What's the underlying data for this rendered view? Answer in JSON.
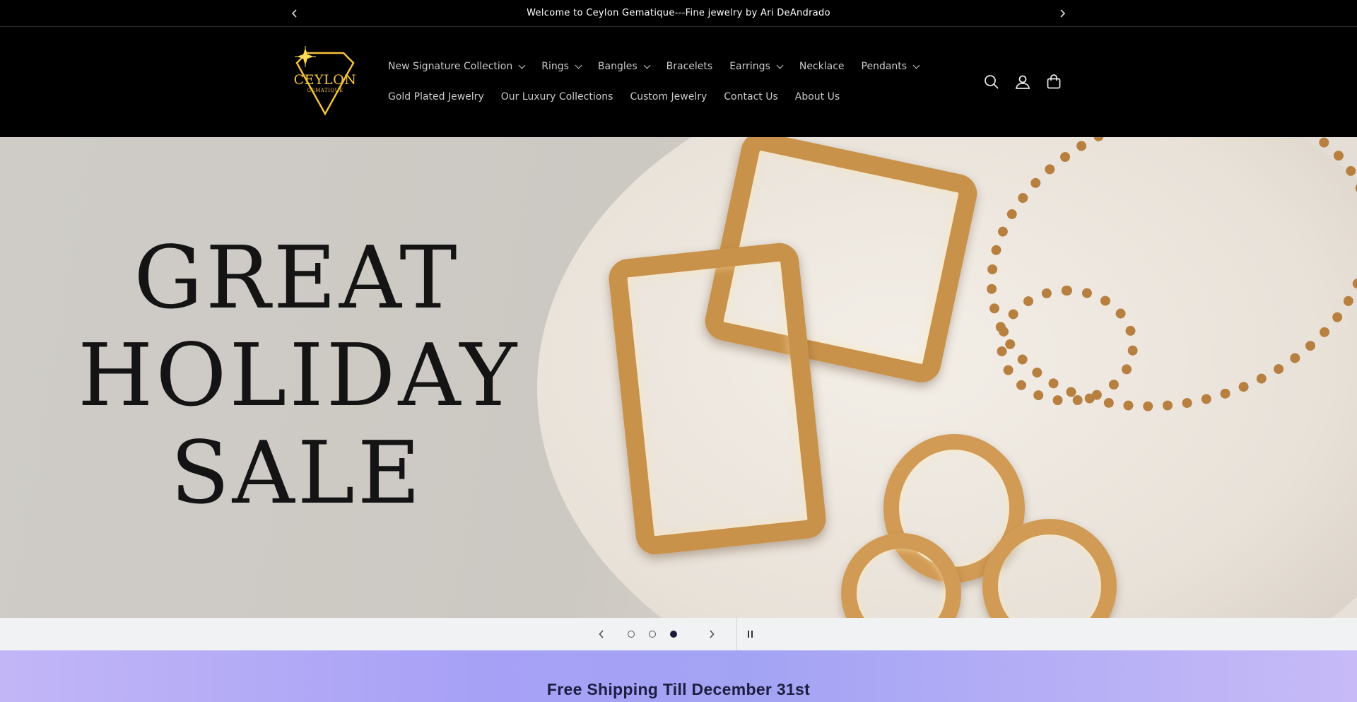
{
  "announcement": {
    "text": "Welcome to Ceylon Gematique---Fine jewelry by Ari DeAndrado"
  },
  "logo": {
    "name": "CEYLON",
    "tagline": "GEMATIQUE",
    "accent_color": "#f3c13a"
  },
  "nav": {
    "row1": [
      {
        "label": "New Signature Collection",
        "dropdown": true
      },
      {
        "label": "Rings",
        "dropdown": true
      },
      {
        "label": "Bangles",
        "dropdown": true
      },
      {
        "label": "Bracelets",
        "dropdown": false
      },
      {
        "label": "Earrings",
        "dropdown": true
      },
      {
        "label": "Necklace",
        "dropdown": false
      },
      {
        "label": "Pendants",
        "dropdown": true
      }
    ],
    "row2": [
      {
        "label": "Gold Plated Jewelry"
      },
      {
        "label": "Our Luxury Collections"
      },
      {
        "label": "Custom Jewelry"
      },
      {
        "label": "Contact Us"
      },
      {
        "label": "About Us"
      }
    ]
  },
  "header_icons": [
    "search-icon",
    "account-icon",
    "cart-icon"
  ],
  "hero": {
    "lines": [
      "GREAT",
      "HOLIDAY",
      "SALE"
    ]
  },
  "slider": {
    "slide_count": 3,
    "active_slide": 3
  },
  "shipping_banner": {
    "text": "Free Shipping Till December 31st"
  },
  "colors": {
    "header_bg": "#000000",
    "nav_text": "#c9c9c9",
    "banner_text": "#1d1e40",
    "gold": "#c8924a"
  }
}
